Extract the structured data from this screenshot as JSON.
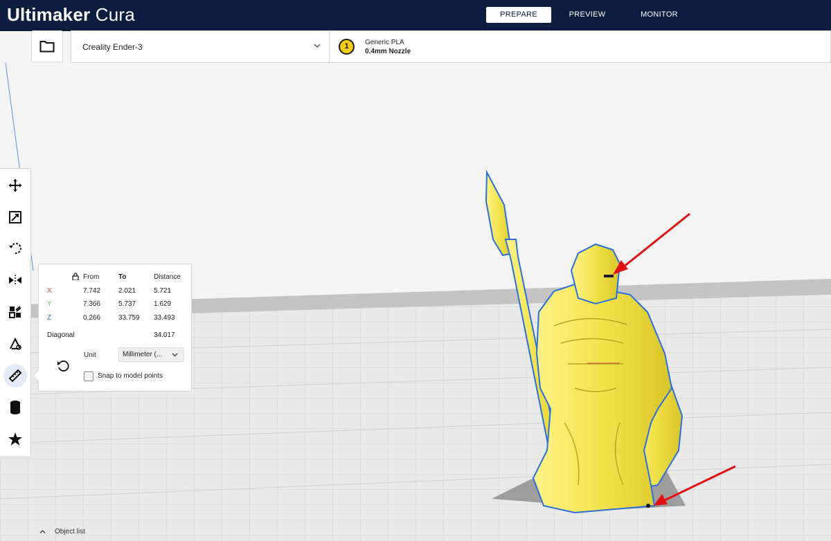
{
  "app": {
    "name_bold": "Ultimaker",
    "name_light": " Cura"
  },
  "stages": [
    {
      "label": "PREPARE",
      "active": true
    },
    {
      "label": "PREVIEW",
      "active": false
    },
    {
      "label": "MONITOR",
      "active": false
    }
  ],
  "printer": {
    "name": "Creality Ender-3"
  },
  "material": {
    "extruder_number": "1",
    "name": "Generic PLA",
    "nozzle": "0.4mm Nozzle",
    "color": "#f4cd1a"
  },
  "tools": [
    {
      "name": "move-tool",
      "icon": "move-icon"
    },
    {
      "name": "scale-tool",
      "icon": "scale-icon"
    },
    {
      "name": "rotate-tool",
      "icon": "rotate-icon"
    },
    {
      "name": "mirror-tool",
      "icon": "mirror-icon"
    },
    {
      "name": "per-model-settings-tool",
      "icon": "per-model-settings-icon"
    },
    {
      "name": "support-blocker-tool",
      "icon": "support-blocker-icon"
    },
    {
      "name": "measure-tool",
      "icon": "ruler-icon",
      "active": true
    },
    {
      "name": "cylinder-tool",
      "icon": "cylinder-icon"
    },
    {
      "name": "custom-supports-tool",
      "icon": "star-icon"
    }
  ],
  "measure": {
    "headers": {
      "from": "From",
      "to": "To",
      "distance": "Distance"
    },
    "rows": [
      {
        "axis": "X",
        "from": "7.742",
        "to": "2.021",
        "distance": "5.721",
        "color": "#d9534f"
      },
      {
        "axis": "Y",
        "from": "7.366",
        "to": "5.737",
        "distance": "1.629",
        "color": "#5cb85c"
      },
      {
        "axis": "Z",
        "from": "0.266",
        "to": "33.759",
        "distance": "33.493",
        "color": "#3b7dd8"
      }
    ],
    "diagonal_label": "Diagonal",
    "diagonal_value": "34.017",
    "unit_label": "Unit",
    "unit_value": "Millimeter (...",
    "snap_label": "Snap to model points",
    "snap_checked": false
  },
  "footer": {
    "object_list_label": "Object list"
  },
  "colors": {
    "header": "#0c1e3f",
    "model": "#f4e85a",
    "outline": "#2a6fdc",
    "annotation_arrow": "#e01010"
  }
}
